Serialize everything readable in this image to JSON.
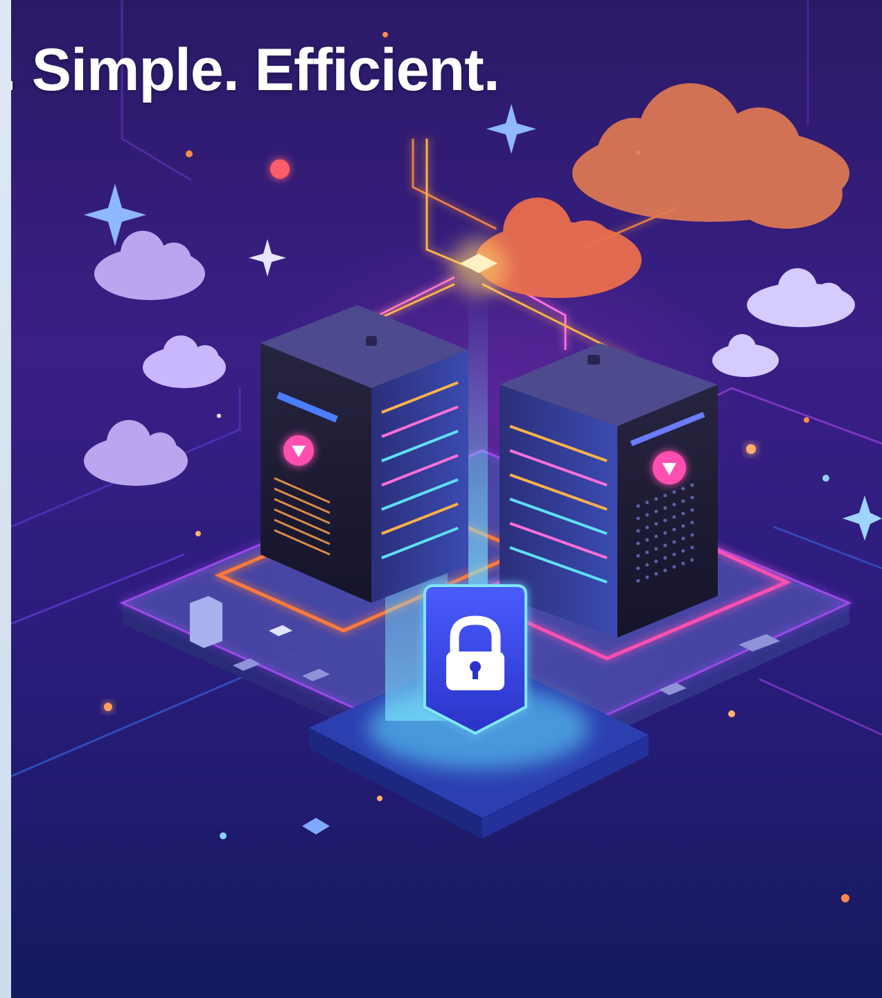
{
  "hero": {
    "headline": ". Simple. Efficient.",
    "icons": [
      "cloud-icon",
      "server-icon",
      "lock-icon",
      "shield-logo-icon",
      "sparkle-icon"
    ]
  },
  "colors": {
    "background_top": "#2a1a66",
    "background_bottom": "#141a5e",
    "neon_pink": "#ff3fa8",
    "neon_orange": "#ff9a3c",
    "neon_cyan": "#3fd6ff",
    "lock_blue": "#3247e8",
    "cloud_orange": "#e07a52",
    "cloud_lilac": "#b9a6ee",
    "left_strip": "#dfe9f5"
  }
}
